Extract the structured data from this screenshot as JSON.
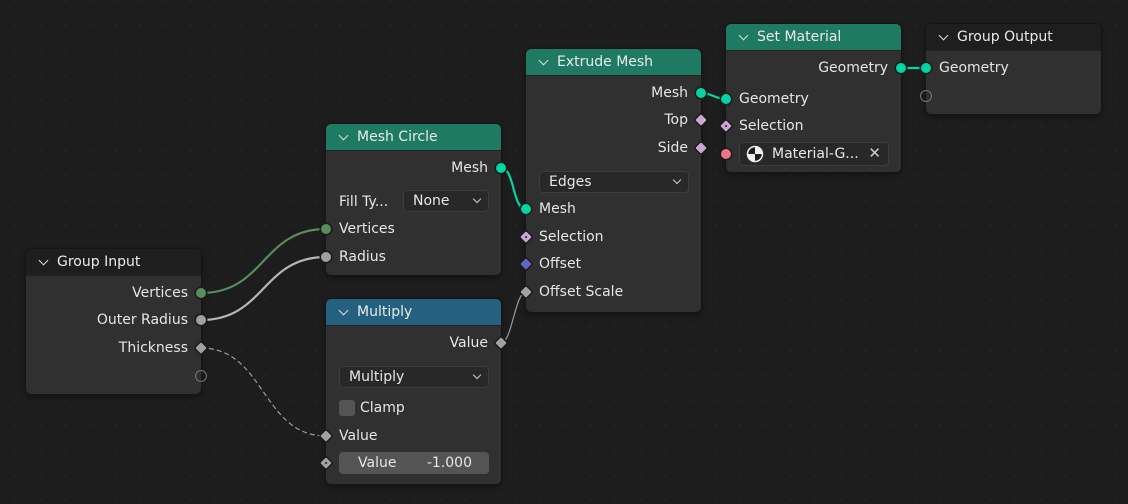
{
  "colors": {
    "geometry": "#00d6a3",
    "int": "#598c5c",
    "float": "#a1a1a1",
    "field_bool": "#cca6d6",
    "vector": "#6363c7",
    "material": "#eb7582",
    "header_geometry": "#1f7a63",
    "header_math": "#24607f"
  },
  "nodes": {
    "group_input": {
      "title": "Group Input",
      "outputs": [
        "Vertices",
        "Outer Radius",
        "Thickness"
      ]
    },
    "mesh_circle": {
      "title": "Mesh Circle",
      "output": "Mesh",
      "fill_label": "Fill Ty...",
      "fill_value": "None",
      "inputs": [
        "Vertices",
        "Radius"
      ]
    },
    "multiply": {
      "title": "Multiply",
      "output": "Value",
      "operation": "Multiply",
      "clamp_label": "Clamp",
      "clamp_checked": false,
      "input_value_label": "Value",
      "field_label": "Value",
      "field_value": "-1.000"
    },
    "extrude_mesh": {
      "title": "Extrude Mesh",
      "outputs": [
        "Mesh",
        "Top",
        "Side"
      ],
      "mode": "Edges",
      "inputs": [
        "Mesh",
        "Selection",
        "Offset",
        "Offset Scale"
      ]
    },
    "set_material": {
      "title": "Set Material",
      "output": "Geometry",
      "inputs": [
        "Geometry",
        "Selection"
      ],
      "material": "Material-G..."
    },
    "group_output": {
      "title": "Group Output",
      "inputs": [
        "Geometry"
      ]
    }
  }
}
